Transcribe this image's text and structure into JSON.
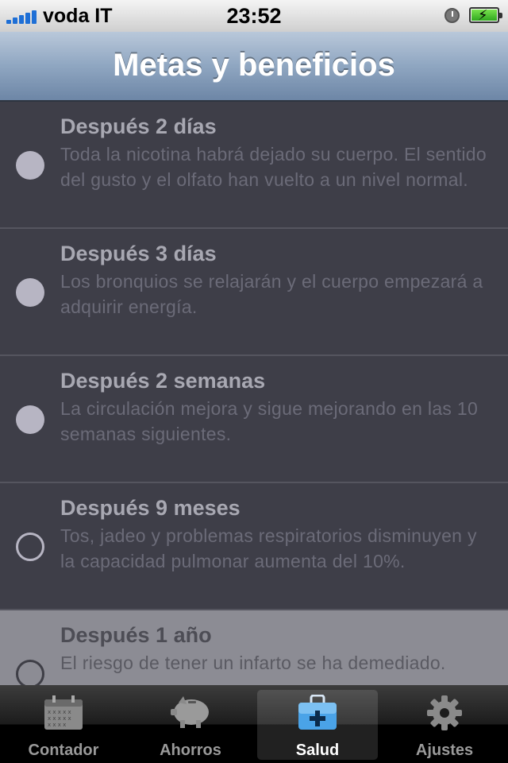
{
  "status_bar": {
    "carrier": "voda IT",
    "time": "23:52",
    "icons": [
      "signal-icon",
      "clock-icon",
      "battery-charging-icon"
    ]
  },
  "navbar": {
    "title": "Metas y beneficios"
  },
  "goals": [
    {
      "title": "Después 2 días",
      "description": "Toda la nicotina habrá dejado su cuerpo. El sentido del gusto y el olfato han vuelto a un nivel normal.",
      "achieved": true
    },
    {
      "title": "Después 3 días",
      "description": "Los bronquios se relajarán y el cuerpo empezará a adquirir energía.",
      "achieved": true
    },
    {
      "title": "Después 2 semanas",
      "description": "La circulación mejora y sigue mejorando en las 10 semanas siguientes.",
      "achieved": true
    },
    {
      "title": "Después 9 meses",
      "description": "Tos, jadeo y problemas respiratorios disminuyen y la capacidad pulmonar aumenta del 10%.",
      "achieved": false
    },
    {
      "title": "Después 1 año",
      "description": "El riesgo de tener un infarto se ha demediado.",
      "achieved": false
    }
  ],
  "tabbar": {
    "tabs": [
      {
        "label": "Contador",
        "icon": "calendar-icon",
        "active": false
      },
      {
        "label": "Ahorros",
        "icon": "piggy-bank-icon",
        "active": false
      },
      {
        "label": "Salud",
        "icon": "medical-kit-icon",
        "active": true
      },
      {
        "label": "Ajustes",
        "icon": "gear-icon",
        "active": false
      }
    ]
  },
  "colors": {
    "accent": "#4aa3e8",
    "background": "#3e3e48",
    "navbar": "#8fa6c1"
  }
}
